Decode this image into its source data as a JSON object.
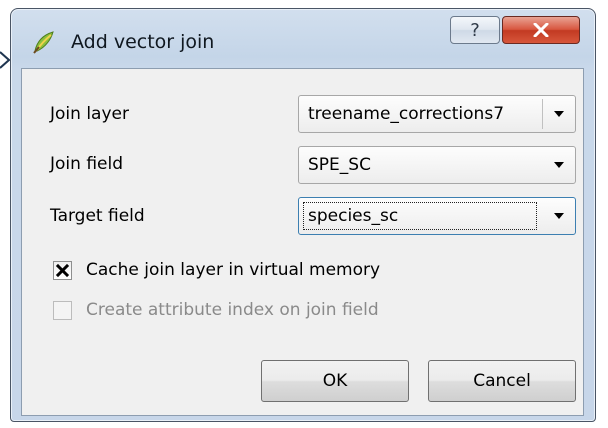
{
  "window": {
    "title": "Add vector join",
    "help_glyph": "?",
    "close_icon": "close-icon",
    "app_icon": "qgis-icon"
  },
  "form": {
    "join_layer_label": "Join layer",
    "join_layer_value": "treename_corrections7",
    "join_field_label": "Join field",
    "join_field_value": "SPE_SC",
    "target_field_label": "Target field",
    "target_field_value": "species_sc"
  },
  "options": {
    "cache_label": "Cache join layer in virtual memory",
    "cache_checked": true,
    "index_label": "Create attribute index on join field",
    "index_checked": false,
    "index_enabled": false
  },
  "buttons": {
    "ok_label": "OK",
    "cancel_label": "Cancel"
  },
  "colors": {
    "frame": "#c7d6e9",
    "close_button": "#c23a22",
    "client_bg": "#f0f0f0",
    "focus": "#3c7fb1"
  }
}
